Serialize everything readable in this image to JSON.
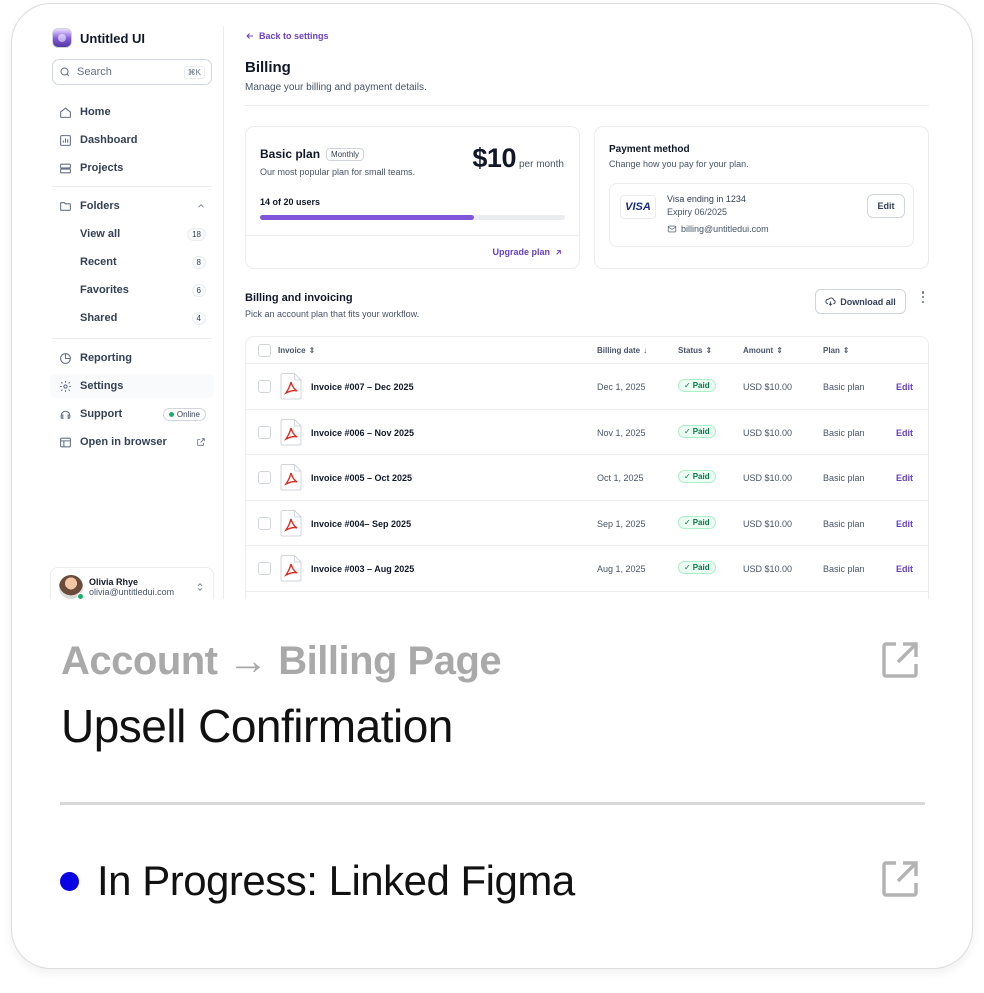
{
  "app": {
    "brand": "Untitled UI",
    "search_placeholder": "Search",
    "search_shortcut": "⌘K"
  },
  "sidebar": {
    "items": [
      {
        "label": "Home",
        "icon": "home-icon"
      },
      {
        "label": "Dashboard",
        "icon": "dashboard-icon"
      },
      {
        "label": "Projects",
        "icon": "projects-icon"
      }
    ],
    "folders": {
      "label": "Folders",
      "items": [
        {
          "label": "View all",
          "count": "18"
        },
        {
          "label": "Recent",
          "count": "8"
        },
        {
          "label": "Favorites",
          "count": "6"
        },
        {
          "label": "Shared",
          "count": "4"
        }
      ]
    },
    "bottom_items": [
      {
        "label": "Reporting",
        "icon": "reporting-icon"
      },
      {
        "label": "Settings",
        "icon": "gear-icon",
        "active": true
      },
      {
        "label": "Support",
        "icon": "support-icon",
        "badge": "Online"
      },
      {
        "label": "Open in browser",
        "icon": "browser-icon"
      }
    ],
    "user": {
      "name": "Olivia Rhye",
      "email": "olivia@untitledui.com"
    }
  },
  "main": {
    "back_link": "Back to settings",
    "title": "Billing",
    "subtitle": "Manage your billing and payment details.",
    "plan": {
      "name": "Basic plan",
      "badge": "Monthly",
      "description": "Our most popular plan for small teams.",
      "price": "$10",
      "price_period": "per month",
      "users": "14 of 20 users",
      "progress_fraction": 0.7,
      "upgrade_label": "Upgrade plan"
    },
    "payment": {
      "title": "Payment method",
      "description": "Change how you pay for your plan.",
      "card_brand": "VISA",
      "card_line": "Visa ending in 1234",
      "expiry": "Expiry 06/2025",
      "email": "billing@untitledui.com",
      "edit_label": "Edit"
    },
    "billing": {
      "title": "Billing and invoicing",
      "subtitle": "Pick an account plan that fits your workflow.",
      "download_label": "Download all",
      "columns": [
        "Invoice",
        "Billing date",
        "Status",
        "Amount",
        "Plan"
      ],
      "rows": [
        {
          "invoice": "Invoice #007 – Dec 2025",
          "date": "Dec 1, 2025",
          "status": "Paid",
          "amount": "USD $10.00",
          "plan": "Basic plan",
          "action": "Edit"
        },
        {
          "invoice": "Invoice #006 – Nov 2025",
          "date": "Nov 1, 2025",
          "status": "Paid",
          "amount": "USD $10.00",
          "plan": "Basic plan",
          "action": "Edit"
        },
        {
          "invoice": "Invoice #005 – Oct 2025",
          "date": "Oct 1, 2025",
          "status": "Paid",
          "amount": "USD $10.00",
          "plan": "Basic plan",
          "action": "Edit"
        },
        {
          "invoice": "Invoice #004– Sep 2025",
          "date": "Sep 1, 2025",
          "status": "Paid",
          "amount": "USD $10.00",
          "plan": "Basic plan",
          "action": "Edit"
        },
        {
          "invoice": "Invoice #003 – Aug 2025",
          "date": "Aug 1, 2025",
          "status": "Paid",
          "amount": "USD $10.00",
          "plan": "Basic plan",
          "action": "Edit"
        }
      ]
    }
  },
  "footer": {
    "breadcrumb": "Account → Billing Page",
    "headline": "Upsell Confirmation",
    "status": "In Progress: Linked Figma",
    "status_color": "#0a00e6"
  }
}
